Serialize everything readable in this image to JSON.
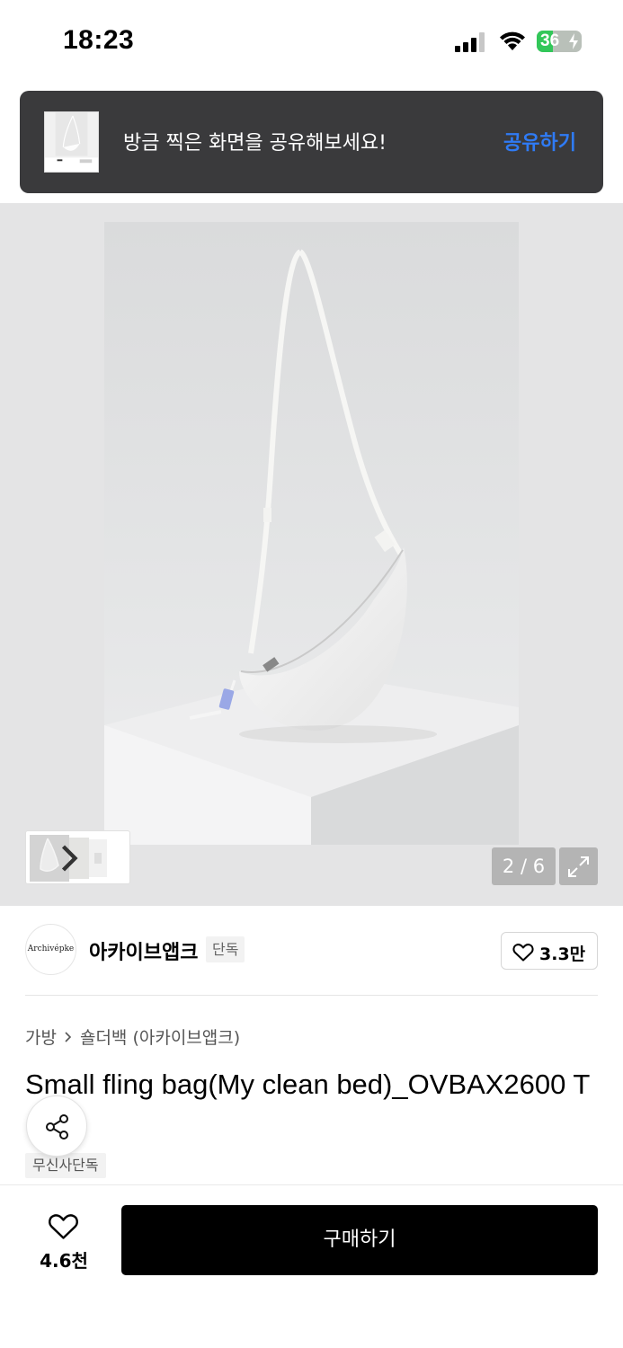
{
  "status_bar": {
    "time": "18:23",
    "battery": "36",
    "battery_level": 0.36,
    "icons": [
      "signal-icon",
      "wifi-icon",
      "battery-charging-icon"
    ]
  },
  "toast": {
    "message": "방금 찍은 화면을 공유해보세요!",
    "action_label": "공유하기",
    "action_color": "#2f7bf5"
  },
  "gallery": {
    "counter": "2 / 6",
    "icons": [
      "chevron-right-icon",
      "expand-icon"
    ]
  },
  "brand": {
    "logo_text": "Archivépke",
    "name": "아카이브앱크",
    "badge": "단독",
    "like_count": "3.3만"
  },
  "product": {
    "breadcrumb": [
      "가방",
      "숄더백 (아카이브앱크)"
    ],
    "title": "Small fling bag(My clean bed)_OVBAX2600 T",
    "badge": "무신사단독"
  },
  "bottom_bar": {
    "wish_count": "4.6천",
    "buy_label": "구매하기"
  },
  "colors": {
    "toast_bg": "#3a3a3c",
    "buy_bg": "#000000",
    "battery_green": "#32c759"
  }
}
